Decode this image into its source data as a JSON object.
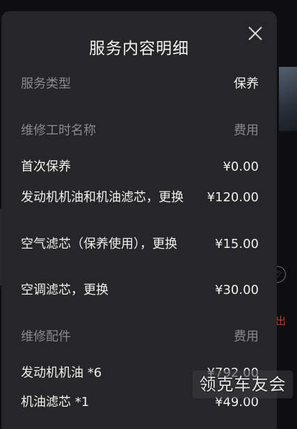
{
  "modal": {
    "title": "服务内容明细"
  },
  "service_type": {
    "label": "服务类型",
    "value": "保养"
  },
  "labor_section": {
    "header_label": "维修工时名称",
    "header_fee": "费用",
    "items": [
      {
        "name": "首次保养",
        "price": "¥0.00"
      },
      {
        "name": "发动机机油和机油滤芯，更换",
        "price": "¥120.00"
      },
      {
        "name": "空气滤芯（保养使用），更换",
        "price": "¥15.00"
      },
      {
        "name": "空调滤芯，更换",
        "price": "¥30.00"
      }
    ]
  },
  "parts_section": {
    "header_label": "维修配件",
    "header_fee": "费用",
    "items": [
      {
        "name": "发动机机油 *6",
        "price": "¥792.00"
      },
      {
        "name": "机油滤芯 *1",
        "price": "¥49.00"
      }
    ]
  },
  "background": {
    "red_text": "出"
  },
  "watermark": {
    "text": "领克车友会"
  }
}
